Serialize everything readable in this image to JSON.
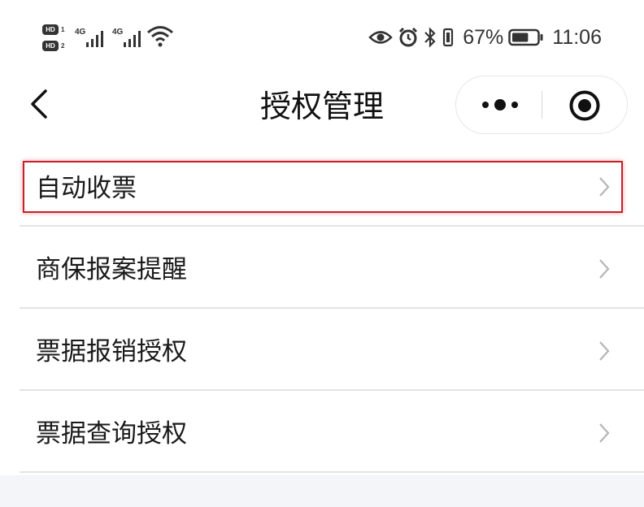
{
  "status_bar": {
    "sim1_badge": "HD",
    "sim1_num": "1",
    "sim2_badge": "HD",
    "sim2_num": "2",
    "network1": "4G",
    "network2": "4G",
    "battery_percent": "67%",
    "time": "11:06",
    "battery_level": 0.67,
    "icons": [
      "eye-icon",
      "alarm-icon",
      "bluetooth-icon",
      "vibrate-icon",
      "battery-icon",
      "wifi-icon",
      "signal-icon"
    ]
  },
  "nav": {
    "title": "授权管理",
    "icons": [
      "back-arrow-icon",
      "more-dots-icon",
      "close-target-icon"
    ]
  },
  "menu": {
    "items": [
      {
        "label": "自动收票",
        "highlighted": true
      },
      {
        "label": "商保报案提醒"
      },
      {
        "label": "票据报销授权"
      },
      {
        "label": "票据查询授权"
      }
    ]
  },
  "colors": {
    "highlight": "#c8202a",
    "background": "#f4f5f8",
    "divider": "#e3e3e3"
  }
}
